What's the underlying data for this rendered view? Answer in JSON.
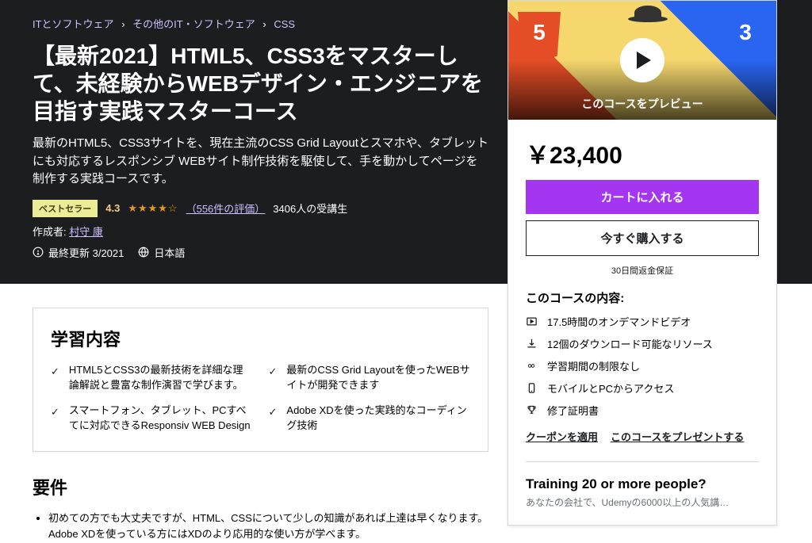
{
  "breadcrumb": {
    "items": [
      "ITとソフトウェア",
      "その他のIT・ソフトウェア",
      "CSS"
    ]
  },
  "course": {
    "title": "【最新2021】HTML5、CSS3をマスターして、未経験からWEBデザイン・エンジニアを目指す実践マスターコース",
    "subtitle": "最新のHTML5、CSS3サイトを、現在主流のCSS Grid Layoutとスマホや、タブレットにも対応するレスポンシブ WEBサイト制作技術を駆使して、手を動かしてページを制作する実践コースです。",
    "badge": "ベストセラー",
    "rating": "4.3",
    "reviews": "（556件の評価）",
    "students": "3406人の受講生",
    "author_label": "作成者:",
    "author_name": "村守 康",
    "last_updated": "最終更新 3/2021",
    "language": "日本語"
  },
  "preview": {
    "caption": "このコースをプレビュー"
  },
  "purchase": {
    "price": "￥23,400",
    "cart_btn": "カートに入れる",
    "buy_btn": "今すぐ購入する",
    "guarantee": "30日間返金保証"
  },
  "includes": {
    "heading": "このコースの内容:",
    "items": [
      "17.5時間のオンデマンドビデオ",
      "12個のダウンロード可能なリソース",
      "学習期間の制限なし",
      "モバイルとPCからアクセス",
      "修了証明書"
    ]
  },
  "links": {
    "coupon": "クーポンを適用",
    "gift": "このコースをプレゼントする"
  },
  "training": {
    "heading": "Training 20 or more people?",
    "sub": "あなたの会社で、Udemyの6000以上の人気講…"
  },
  "learn": {
    "heading": "学習内容",
    "items": [
      "HTML5とCSS3の最新技術を詳細な理論解説と豊富な制作演習で学びます。",
      "最新のCSS Grid Layoutを使ったWEBサイトが開発できます",
      "スマートフォン、タブレット、PCすべてに対応できるResponsiv WEB Design",
      "Adobe XDを使った実践的なコーディング技術"
    ]
  },
  "requirements": {
    "heading": "要件",
    "items": [
      "初めての方でも大丈夫ですが、HTML、CSSについて少しの知識があれば上達は早くなります。Adobe XDを使っている方にはXDのより応用的な使い方が学べます。"
    ]
  }
}
